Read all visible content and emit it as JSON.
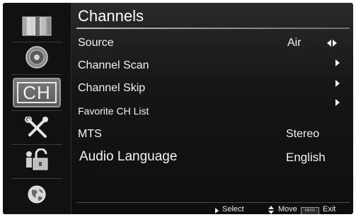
{
  "title": "Channels",
  "sidebar": {
    "items": [
      {
        "icon": "tv-picture-icon",
        "label": ""
      },
      {
        "icon": "speaker-icon",
        "label": ""
      },
      {
        "icon": "channel-icon",
        "label": "CH"
      },
      {
        "icon": "tools-icon",
        "label": ""
      },
      {
        "icon": "parental-lock-icon",
        "label": ""
      },
      {
        "icon": "globe-icon",
        "label": ""
      }
    ],
    "selected_index": 2
  },
  "menu": [
    {
      "label": "Source",
      "value": "Air",
      "control": "left-right-arrows"
    },
    {
      "label": "Channel Scan",
      "value": "",
      "control": "right-arrow"
    },
    {
      "label": "Channel Skip",
      "value": "",
      "control": "right-arrow"
    },
    {
      "label": "Favorite CH List",
      "value": "",
      "control": "right-arrow"
    },
    {
      "label": "MTS",
      "value": "Stereo",
      "control": ""
    },
    {
      "label": "Audio Language",
      "value": "English",
      "control": ""
    }
  ],
  "hints": {
    "select": "Select",
    "move": "Move",
    "menu_key": "MENU",
    "exit": "Exit"
  },
  "colors": {
    "background": "#0e0e0e",
    "selected_tab": "#6a6a6a",
    "text": "#f3f3f3"
  }
}
